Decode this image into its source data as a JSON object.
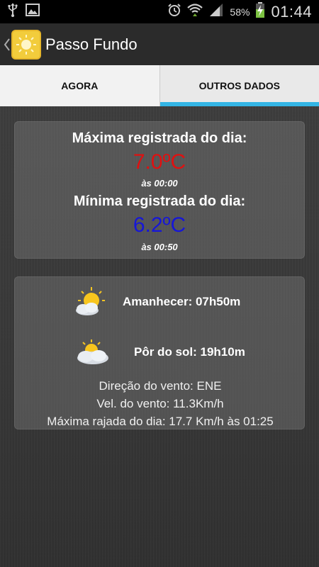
{
  "status_bar": {
    "battery_percent": "58%",
    "clock": "01:44"
  },
  "action_bar": {
    "title": "Passo Fundo"
  },
  "tabs": [
    {
      "label": "AGORA",
      "selected": false
    },
    {
      "label": "OUTROS DADOS",
      "selected": true
    }
  ],
  "temperature_card": {
    "max_label": "Máxima registrada do dia:",
    "max_value": "7.0ºC",
    "max_time": "às 00:00",
    "min_label": "Mínima registrada do dia:",
    "min_value": "6.2ºC",
    "min_time": "às 00:50"
  },
  "sun_wind_card": {
    "sunrise": "Amanhecer: 07h50m",
    "sunset": "Pôr do sol: 19h10m",
    "wind_direction": "Direção do vento: ENE",
    "wind_speed": "Vel. do vento: 11.3Km/h",
    "max_gust": "Máxima rajada do dia: 17.7 Km/h às 01:25"
  },
  "colors": {
    "accent": "#33b5e5",
    "max_temp": "#e01010",
    "min_temp": "#1616d8"
  }
}
